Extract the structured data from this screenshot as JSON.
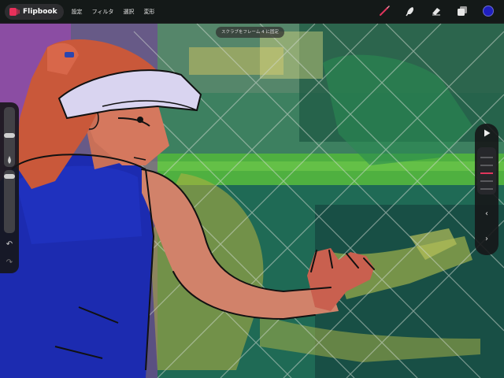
{
  "app": {
    "name": "Flipbook",
    "logo_color": "#e8305a"
  },
  "menu": [
    {
      "label": "設定"
    },
    {
      "label": "フィルタ"
    },
    {
      "label": "選択"
    },
    {
      "label": "変形"
    }
  ],
  "tools": [
    {
      "icon": "brush-icon",
      "active": true,
      "color": "#e0355c"
    },
    {
      "icon": "smudge-icon",
      "active": false
    },
    {
      "icon": "eraser-icon",
      "active": false
    },
    {
      "icon": "layers-icon",
      "active": false
    },
    {
      "icon": "color-swatch",
      "color": "#1f1fbf"
    }
  ],
  "hint": "スクラブをフレーム 4 に固定",
  "left_sidebar": {
    "icons": [
      "undo-icon",
      "redo-icon"
    ],
    "undo_glyph": "↶",
    "redo_glyph": "↷"
  },
  "right_panel": {
    "icons": [
      "play-icon",
      "previous-frame-icon",
      "next-frame-icon"
    ],
    "current_frame_color": "#e0355c",
    "prev_glyph": "‹",
    "next_glyph": "›"
  }
}
